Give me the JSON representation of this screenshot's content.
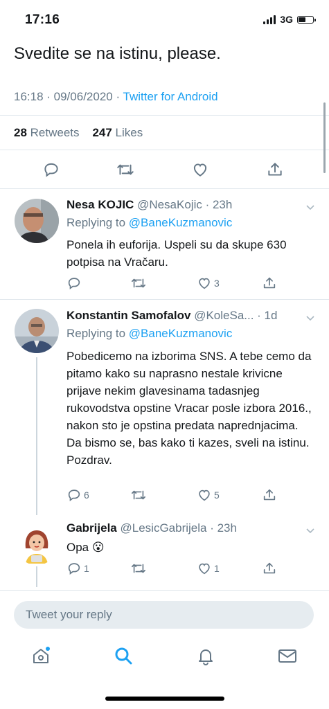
{
  "status_bar": {
    "time": "17:16",
    "network": "3G"
  },
  "tweet": {
    "text": "Svedite se na istinu, please.",
    "timestamp": "16:18 · 09/06/2020 · ",
    "source": "Twitter for Android",
    "retweets_count": "28",
    "retweets_label": "Retweets",
    "likes_count": "247",
    "likes_label": "Likes"
  },
  "replies": [
    {
      "name": "Nesa KOJIC",
      "handle": "@NesaKojic · 23h",
      "replying_prefix": "Replying to ",
      "replying_to": "@BaneKuzmanovic",
      "text": "Ponela ih euforija. Uspeli su da skupe 630 potpisa na Vračaru.",
      "replies_count": "",
      "likes_count": "3"
    },
    {
      "name": "Konstantin Samofalov",
      "handle": "@KoleSa... · 1d",
      "replying_prefix": "Replying to ",
      "replying_to": "@BaneKuzmanovic",
      "text": "Pobedicemo na izborima SNS. A tebe cemo da pitamo kako su naprasno nestale krivicne prijave nekim glavesinama tadasnjeg rukovodstva opstine Vracar posle izbora 2016., nakon sto je opstina predata naprednjacima. Da bismo se, bas kako ti kazes, sveli na istinu. Pozdrav.",
      "replies_count": "6",
      "likes_count": "5"
    },
    {
      "name": "Gabrijela",
      "handle": "@LesicGabrijela · 23h",
      "text": "Opa 😮",
      "replies_count": "1",
      "likes_count": "1"
    }
  ],
  "composer": {
    "placeholder": "Tweet your reply"
  },
  "colors": {
    "accent": "#1da1f2",
    "secondary_text": "#657786",
    "divider": "#e1e8ed"
  },
  "tabs": [
    "home-icon",
    "search-icon",
    "notifications-icon",
    "messages-icon"
  ]
}
